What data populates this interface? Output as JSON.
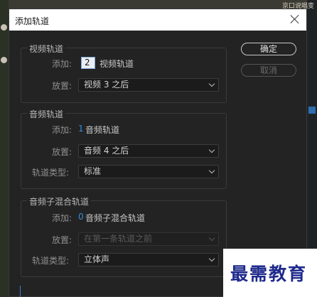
{
  "background": {
    "top_text": "京口说唱变"
  },
  "dialog": {
    "title": "添加轨道",
    "buttons": {
      "ok": "确定",
      "cancel": "取消"
    },
    "video": {
      "group": "视频轨道",
      "add_label": "添加:",
      "add_value": "2",
      "add_unit": "视频轨道",
      "place_label": "放置:",
      "place_value": "视频 3 之后"
    },
    "audio": {
      "group": "音频轨道",
      "add_label": "添加:",
      "add_value": "1",
      "add_unit": "音频轨道",
      "place_label": "放置:",
      "place_value": "音频 4 之后",
      "type_label": "轨道类型:",
      "type_value": "标准"
    },
    "submix": {
      "group": "音频子混合轨道",
      "add_label": "添加:",
      "add_value": "0",
      "add_unit": "音频子混合轨道",
      "place_label": "放置:",
      "place_value": "在第一条轨道之前",
      "type_label": "轨道类型:",
      "type_value": "立体声"
    }
  },
  "watermark": {
    "text": "最需教育"
  },
  "colors": {
    "accent_blue": "#2f8fe0",
    "dialog_bg": "#232323",
    "watermark_blue": "#1e2a8c"
  }
}
